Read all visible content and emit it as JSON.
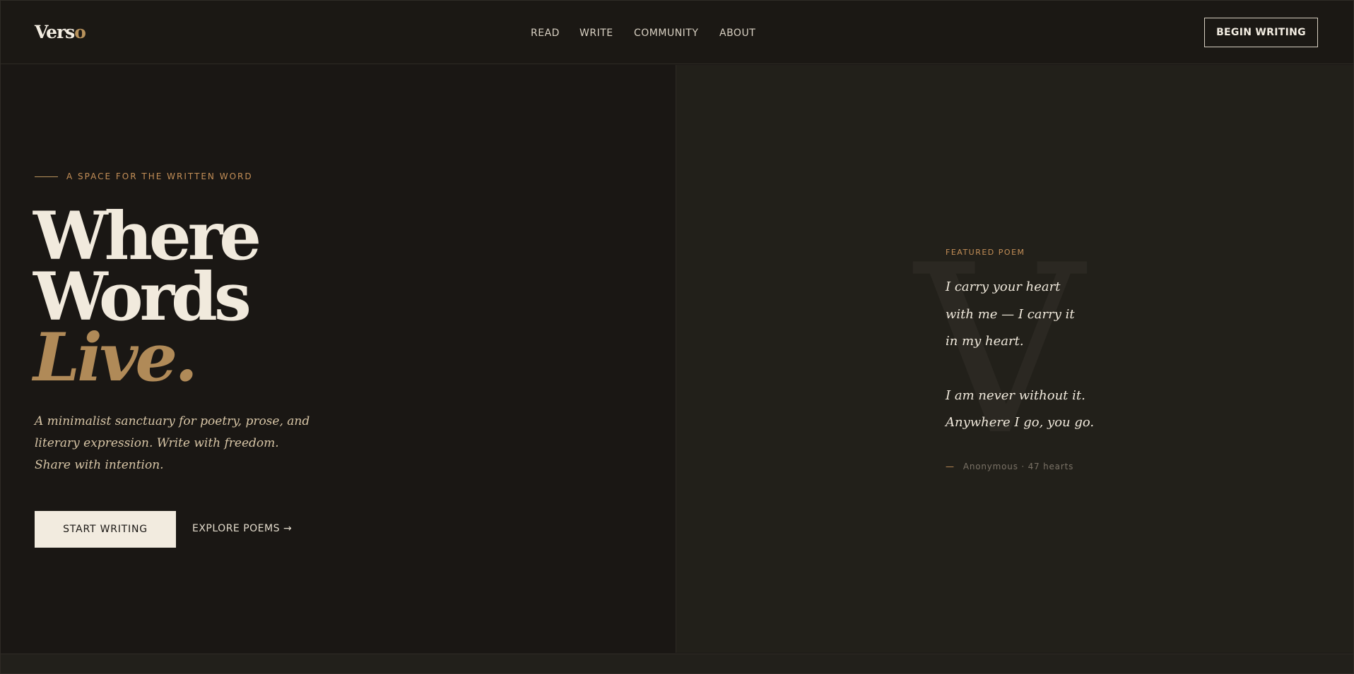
{
  "brand": {
    "logo_main": "Vers",
    "logo_accent": "o",
    "accent_color": "#b8925c"
  },
  "nav": {
    "items": [
      {
        "label": "READ"
      },
      {
        "label": "WRITE"
      },
      {
        "label": "COMMUNITY"
      },
      {
        "label": "ABOUT"
      }
    ],
    "cta": "BEGIN WRITING"
  },
  "hero": {
    "eyebrow": "A SPACE FOR THE WRITTEN WORD",
    "headline": {
      "line1": "Where",
      "line2": "Words",
      "line3": "Live."
    },
    "subcopy": "A minimalist sanctuary for poetry, prose, and literary expression. Write with freedom. Share with intention.",
    "primary_button": "START WRITING",
    "secondary_link": "EXPLORE POEMS →"
  },
  "featured": {
    "decor_letter": "V",
    "label": "FEATURED POEM",
    "stanza1": [
      "I carry your heart",
      "with me — I carry it",
      "in my heart."
    ],
    "stanza2": [
      "I am never without it.",
      "Anywhere I go, you go."
    ],
    "attribution_dash": "—",
    "attribution": "Anonymous · 47 hearts"
  },
  "colors": {
    "background": "#1a1714",
    "panel": "#22201a",
    "text": "#f1eadd",
    "accent": "#b08a58"
  }
}
